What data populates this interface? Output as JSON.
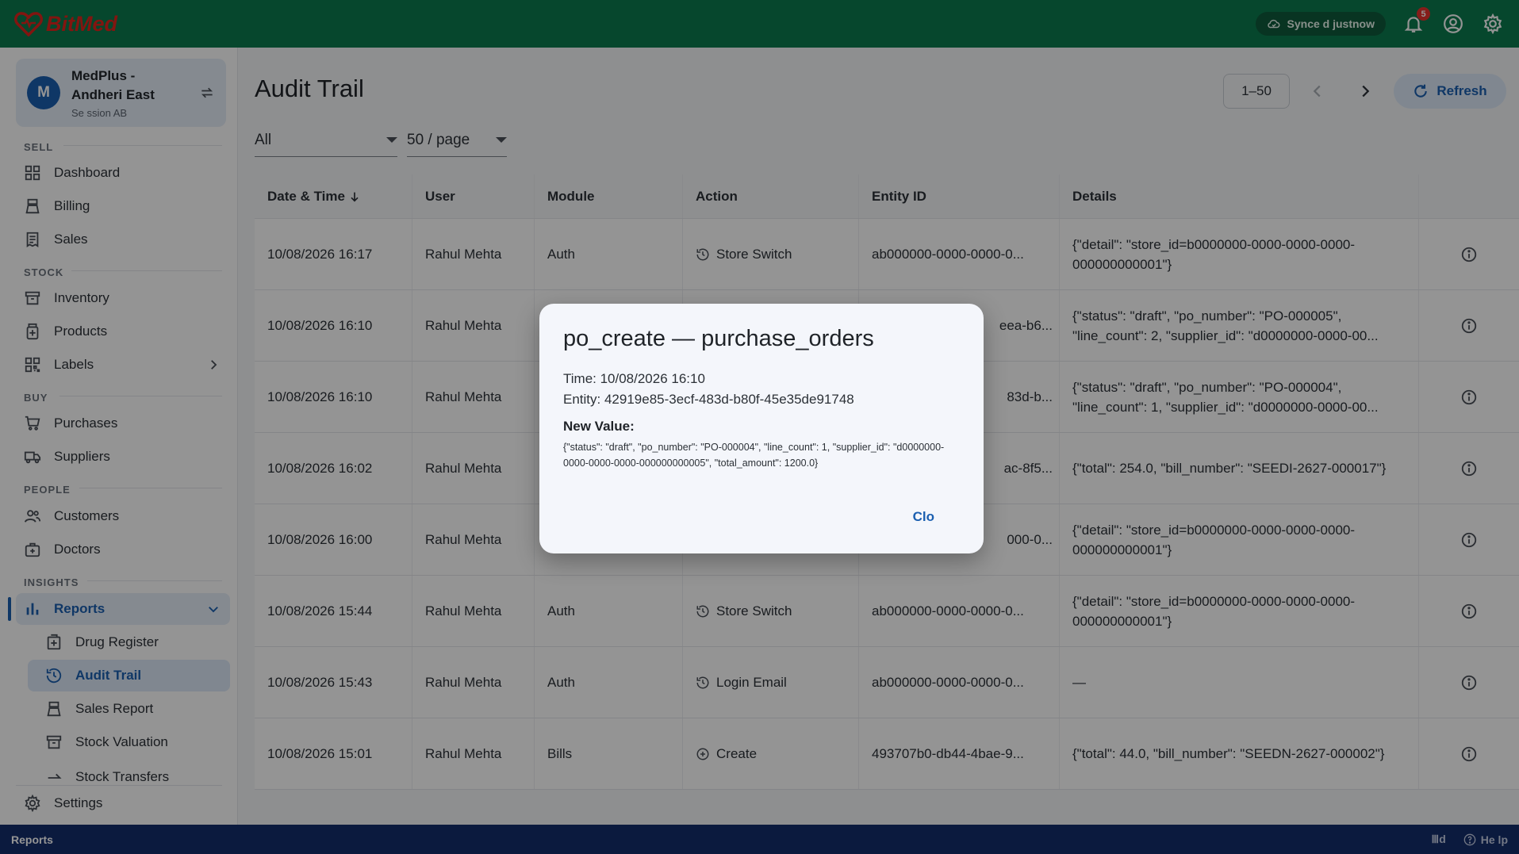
{
  "app": {
    "brand": "BitMed"
  },
  "topbar": {
    "sync_label": "Synce d justnow",
    "notification_count": "5"
  },
  "sidebar": {
    "store": {
      "avatar_letter": "M",
      "name": "MedPlus - Andheri East",
      "session": "Se ssion AB"
    },
    "sections": {
      "sell": "SELL",
      "stock": "STOCK",
      "buy": "BUY",
      "people": "PEOPLE",
      "insights": "INSIGHTS"
    },
    "items": {
      "dashboard": "Dashboard",
      "billing": "Billing",
      "sales": "Sales",
      "inventory": "Inventory",
      "products": "Products",
      "labels": "Labels",
      "purchases": "Purchases",
      "suppliers": "Suppliers",
      "customers": "Customers",
      "doctors": "Doctors",
      "reports": "Reports",
      "drug_register": "Drug Register",
      "audit_trail": "Audit Trail",
      "sales_report": "Sales Report",
      "stock_valuation": "Stock Valuation",
      "stock_transfers": "Stock Transfers",
      "settings": "Settings"
    }
  },
  "main": {
    "title": "Audit Trail",
    "range": "1–50",
    "refresh_label": "Refresh",
    "filter_value": "All",
    "page_size": "50 / page",
    "columns": [
      "Date & Time",
      "User",
      "Module",
      "Action",
      "Entity ID",
      "Details"
    ],
    "rows": [
      {
        "datetime": "10/08/2026 16:17",
        "user": "Rahul Mehta",
        "module": "Auth",
        "action": "Store Switch",
        "action_icon": "history-icon",
        "entity": "ab000000-0000-0000-0...",
        "details": "{\"detail\": \"store_id=b0000000-0000-0000-0000-000000000001\"}"
      },
      {
        "datetime": "10/08/2026 16:10",
        "user": "Rahul Mehta",
        "module": "",
        "action": "",
        "action_icon": "",
        "entity": "eea-b6...",
        "details": "{\"status\": \"draft\", \"po_number\": \"PO-000005\", \"line_count\": 2, \"supplier_id\": \"d0000000-0000-00..."
      },
      {
        "datetime": "10/08/2026 16:10",
        "user": "Rahul Mehta",
        "module": "",
        "action": "",
        "action_icon": "",
        "entity": "83d-b...",
        "details": "{\"status\": \"draft\", \"po_number\": \"PO-000004\", \"line_count\": 1, \"supplier_id\": \"d0000000-0000-00..."
      },
      {
        "datetime": "10/08/2026 16:02",
        "user": "Rahul Mehta",
        "module": "",
        "action": "",
        "action_icon": "",
        "entity": "ac-8f5...",
        "details": "{\"total\": 254.0, \"bill_number\": \"SEEDI-2627-000017\"}"
      },
      {
        "datetime": "10/08/2026 16:00",
        "user": "Rahul Mehta",
        "module": "",
        "action": "",
        "action_icon": "",
        "entity": "000-0...",
        "details": "{\"detail\": \"store_id=b0000000-0000-0000-0000-000000000001\"}"
      },
      {
        "datetime": "10/08/2026 15:44",
        "user": "Rahul Mehta",
        "module": "Auth",
        "action": "Store Switch",
        "action_icon": "history-icon",
        "entity": "ab000000-0000-0000-0...",
        "details": "{\"detail\": \"store_id=b0000000-0000-0000-0000-000000000001\"}"
      },
      {
        "datetime": "10/08/2026 15:43",
        "user": "Rahul Mehta",
        "module": "Auth",
        "action": "Login Email",
        "action_icon": "history-icon",
        "entity": "ab000000-0000-0000-0...",
        "details": "—"
      },
      {
        "datetime": "10/08/2026 15:01",
        "user": "Rahul Mehta",
        "module": "Bills",
        "action": "Create",
        "action_icon": "plus-circle-icon",
        "entity": "493707b0-db44-4bae-9...",
        "details": "{\"total\": 44.0, \"bill_number\": \"SEEDN-2627-000002\"}"
      }
    ]
  },
  "dialog": {
    "title": "po_create — purchase_orders",
    "time": "Time: 10/08/2026 16:10",
    "entity": "Entity: 42919e85-3ecf-483d-b80f-45e35de91748",
    "new_value_label": "New Value:",
    "new_value": "{\"status\": \"draft\", \"po_number\": \"PO-000004\", \"line_count\": 1, \"supplier_id\": \"d0000000-0000-0000-0000-000000000005\", \"total_amount\": 1200.0}",
    "close_label": "Clo"
  },
  "statusbar": {
    "left": "Reports",
    "mid": "Ⅲd",
    "help": "He lp"
  },
  "colors": {
    "topbar": "#0c7a4e",
    "brand_red": "#e0251d",
    "accent": "#1b5fb0",
    "statusbar": "#142d6c"
  }
}
